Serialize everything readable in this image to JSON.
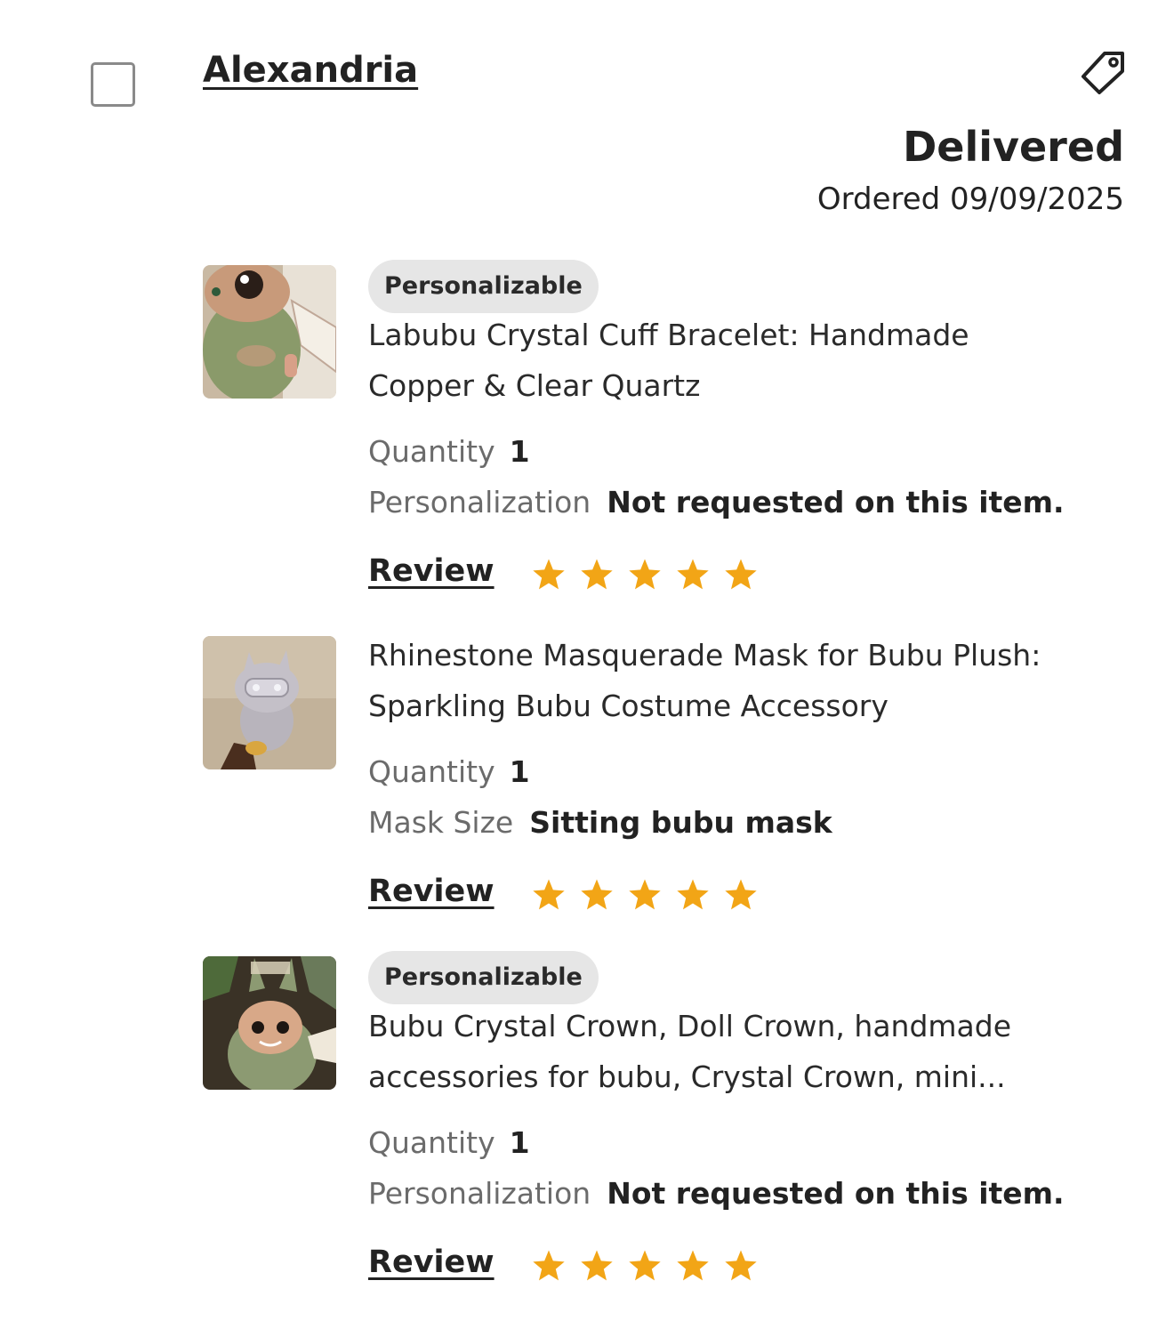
{
  "order": {
    "buyer_name": "Alexandria",
    "status": "Delivered",
    "ordered_text": "Ordered 09/09/2025",
    "icons": {
      "checkbox": "checkbox-icon",
      "tag": "tag-icon",
      "star": "star-icon"
    },
    "colors": {
      "star": "#F2A516",
      "badge_bg": "#E6E6E6",
      "label": "#6B6B6B",
      "text": "#222222"
    }
  },
  "items": [
    {
      "badge": "Personalizable",
      "title_line1": "Labubu Crystal Cuff Bracelet: Handmade",
      "title_line2": "Copper & Clear Quartz",
      "quantity_label": "Quantity",
      "quantity_value": "1",
      "option_label": "Personalization",
      "option_value": "Not requested on this item.",
      "review_label": "Review",
      "rating": 5
    },
    {
      "title_line1": "Rhinestone Masquerade Mask for Bubu Plush:",
      "title_line2": "Sparkling Bubu Costume Accessory",
      "quantity_label": "Quantity",
      "quantity_value": "1",
      "option_label": "Mask Size",
      "option_value": "Sitting bubu mask",
      "review_label": "Review",
      "rating": 5
    },
    {
      "badge": "Personalizable",
      "title_line1": "Bubu Crystal Crown, Doll Crown, handmade",
      "title_line2": "accessories for bubu, Crystal Crown, mini...",
      "quantity_label": "Quantity",
      "quantity_value": "1",
      "option_label": "Personalization",
      "option_value": "Not requested on this item.",
      "review_label": "Review",
      "rating": 5
    }
  ]
}
